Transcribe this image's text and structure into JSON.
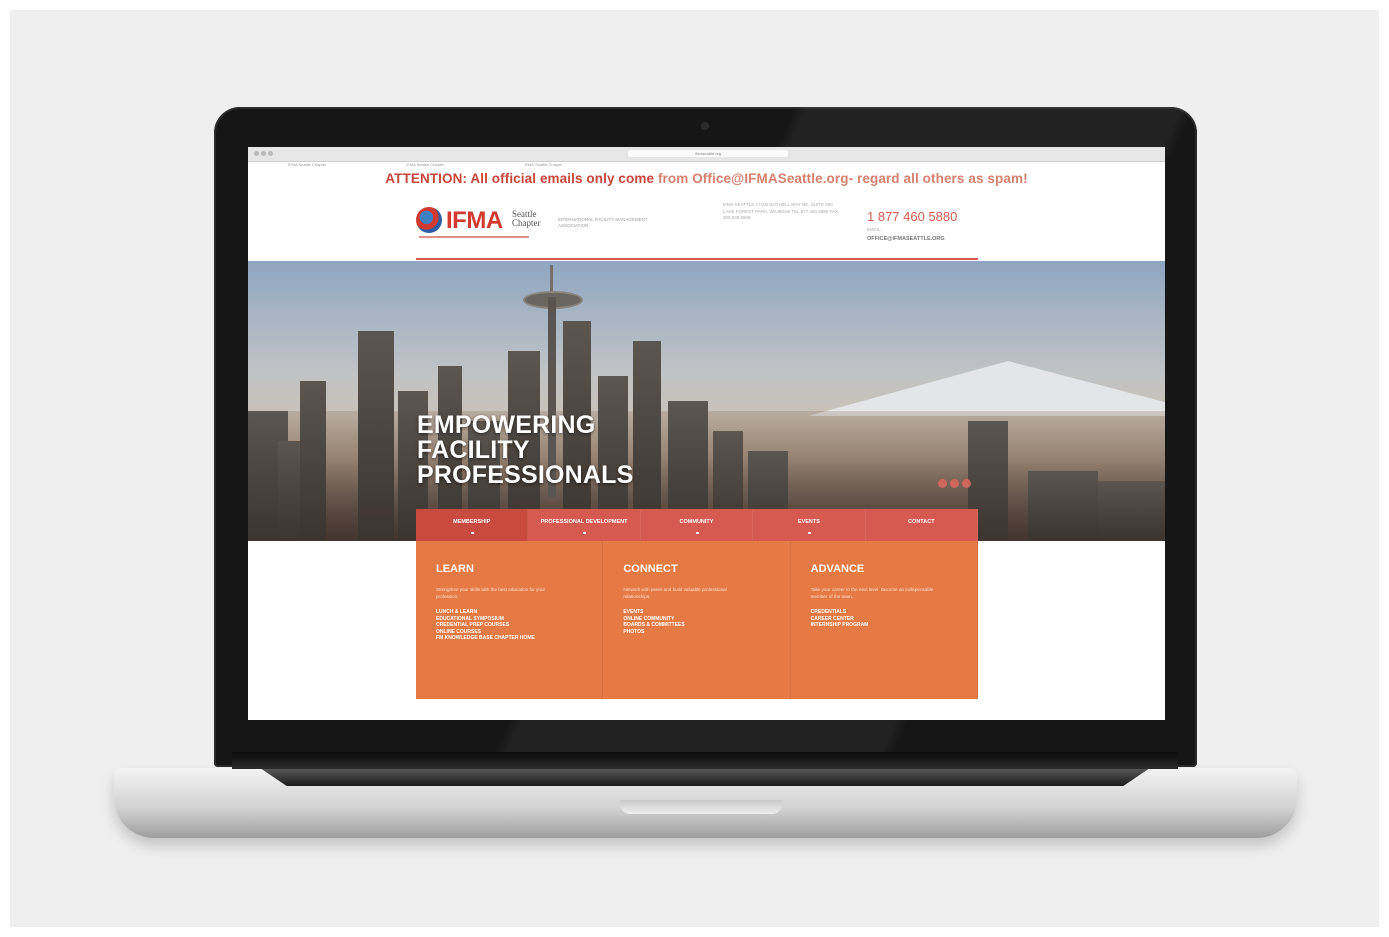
{
  "browser": {
    "url": "ifmaseattle.org",
    "tabs": [
      "IFMA Seattle Chapter",
      "IFMA Seattle Chapter",
      "IFMA Seattle Chapter"
    ]
  },
  "attention": {
    "bold": "ATTENTION: All official emails only come",
    "rest": "from Office@IFMASeattle.org- regard all others as spam!"
  },
  "header": {
    "logo_word": "IFMA",
    "logo_chapter": "Seattle Chapter",
    "logo_assoc": "INTERNATIONAL FACILITY MANAGEMENT ASSOCIATION",
    "address": "IFMA SEATTLE 17100 BOTHELL WAY NE, SUITE 290 LAKE FOREST PARK, WA 98155 TEL 877.460.5880 FAX 206.838.8608",
    "phone": "1 877 460 5880",
    "email_label": "EMAIL:",
    "email": "OFFICE@IFMASEATTLE.ORG"
  },
  "hero": {
    "line1": "EMPOWERING",
    "line2": "FACILITY",
    "line3": "PROFESSIONALS"
  },
  "nav": [
    {
      "label": "MEMBERSHIP"
    },
    {
      "label": "PROFESSIONAL DEVELOPMENT"
    },
    {
      "label": "COMMUNITY"
    },
    {
      "label": "EVENTS"
    },
    {
      "label": "CONTACT"
    }
  ],
  "panels": [
    {
      "title": "LEARN",
      "desc": "Strengthen your skills with the best education for your profession.",
      "links": [
        "LUNCH & LEARN",
        "EDUCATIONAL SYMPOSIUM",
        "CREDENTIAL PREP COURSES",
        "ONLINE COURSES",
        "FM KNOWLEDGE BASE CHAPTER HOME"
      ]
    },
    {
      "title": "CONNECT",
      "desc": "Network with peers and build valuable professional relationships.",
      "links": [
        "EVENTS",
        "ONLINE COMMUNITY",
        "BOARDS & COMMITTEES",
        "PHOTOS"
      ]
    },
    {
      "title": "ADVANCE",
      "desc": "Take your career to the next level. Become an indispensable member of the team.",
      "links": [
        "CREDENTIALS",
        "CAREER CENTER",
        "INTERNSHIP PROGRAM"
      ]
    }
  ],
  "colors": {
    "accent": "#d65a4f",
    "panel": "#e57a45",
    "attention": "#c8453a"
  }
}
